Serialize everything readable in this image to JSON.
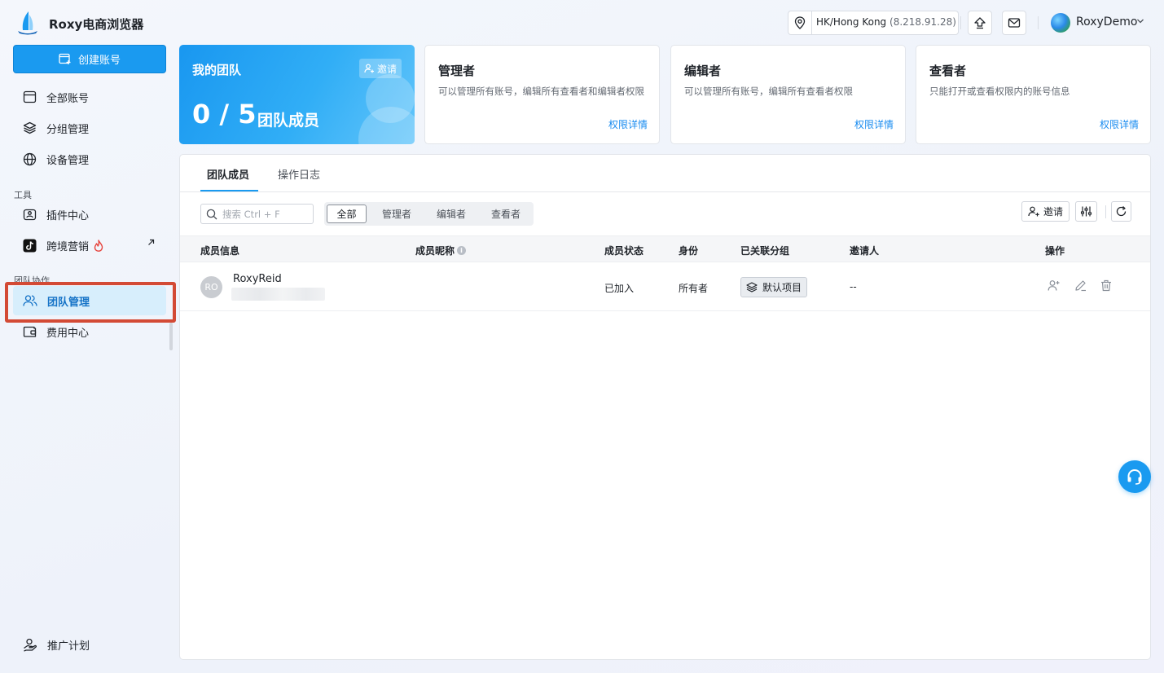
{
  "header": {
    "app_title": "Roxy电商浏览器",
    "location": "HK/Hong Kong",
    "ip": "(8.218.91.28)",
    "user_name": "RoxyDemo"
  },
  "sidebar": {
    "create_label": "创建账号",
    "items": [
      {
        "label": "全部账号",
        "icon": "browser-window-icon"
      },
      {
        "label": "分组管理",
        "icon": "layers-icon"
      },
      {
        "label": "设备管理",
        "icon": "globe-icon"
      },
      {
        "label": "插件中心",
        "icon": "puzzle-icon"
      },
      {
        "label": "跨境营销",
        "icon": "tiktok-icon"
      },
      {
        "label": "团队管理",
        "icon": "users-icon"
      },
      {
        "label": "费用中心",
        "icon": "wallet-icon"
      },
      {
        "label": "推广计划",
        "icon": "referral-icon"
      }
    ],
    "section_tools": "工具",
    "section_team": "团队协作"
  },
  "team_card": {
    "title": "我的团队",
    "invite_label": "邀请",
    "count": "0 / 5",
    "count_label": "团队成员"
  },
  "roles": [
    {
      "title": "管理者",
      "desc": "可以管理所有账号，编辑所有查看者和编辑者权限",
      "link": "权限详情"
    },
    {
      "title": "编辑者",
      "desc": "可以管理所有账号，编辑所有查看者权限",
      "link": "权限详情"
    },
    {
      "title": "查看者",
      "desc": "只能打开或查看权限内的账号信息",
      "link": "权限详情"
    }
  ],
  "tabs": [
    "团队成员",
    "操作日志"
  ],
  "search": {
    "placeholder": "搜索 Ctrl + F"
  },
  "filters": [
    "全部",
    "管理者",
    "编辑者",
    "查看者"
  ],
  "toolbar": {
    "invite_label": "邀请"
  },
  "table": {
    "headers": [
      "成员信息",
      "成员昵称",
      "成员状态",
      "身份",
      "已关联分组",
      "邀请人",
      "操作"
    ],
    "rows": [
      {
        "avatar": "RO",
        "name": "RoxyReid",
        "status": "已加入",
        "role": "所有者",
        "group": "默认项目",
        "inviter": "--"
      }
    ]
  },
  "colors": {
    "accent": "#1a9af0",
    "highlight": "#d34a35"
  }
}
